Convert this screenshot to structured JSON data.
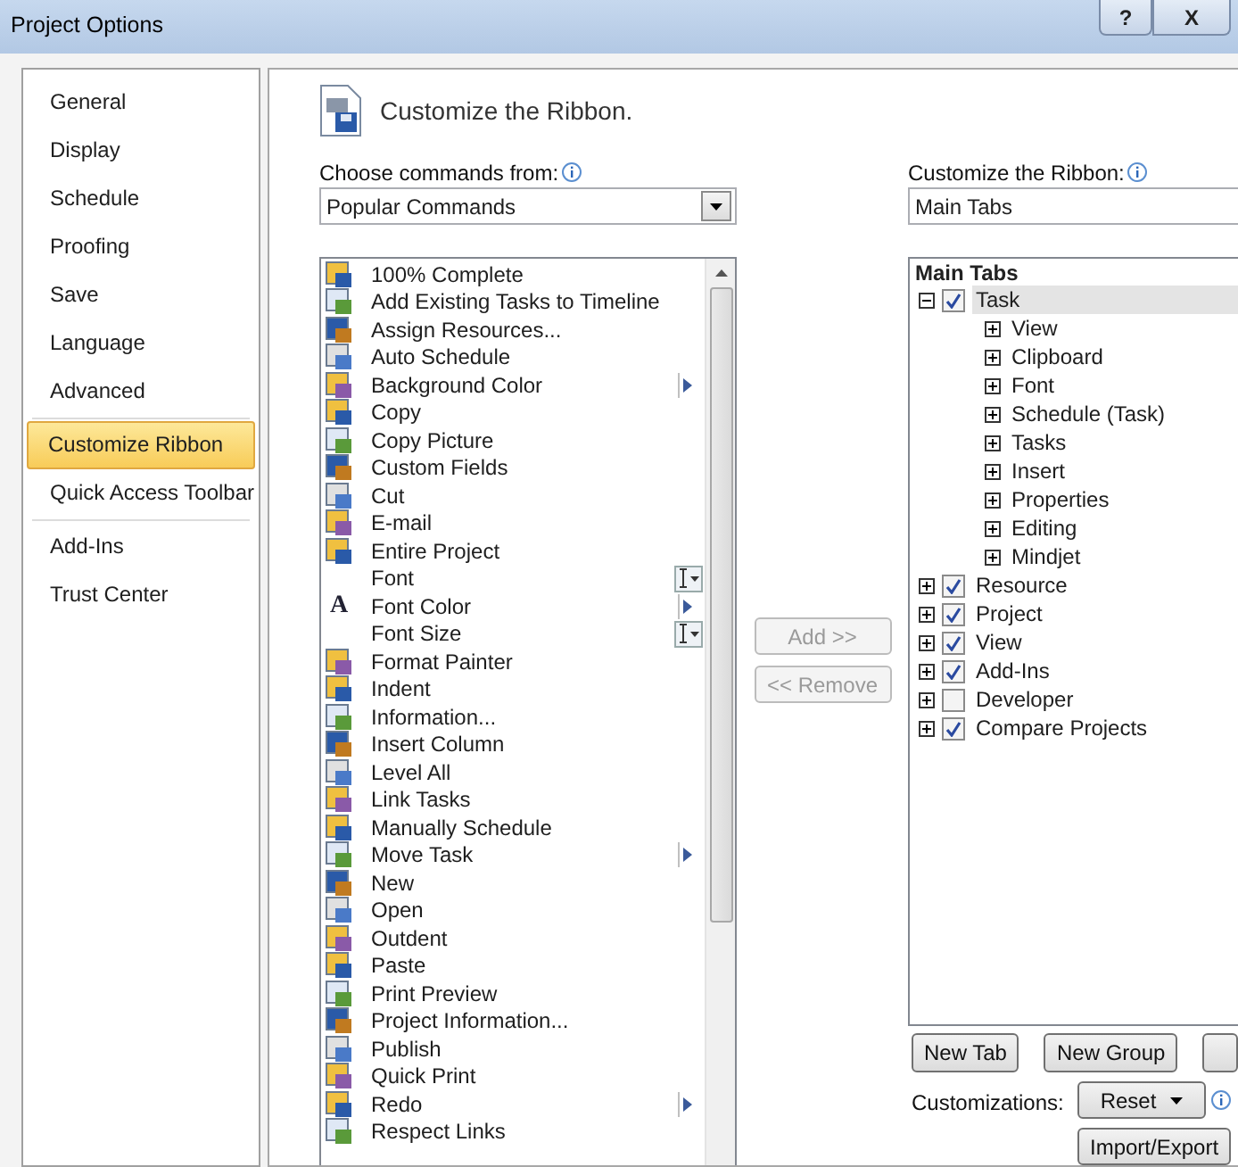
{
  "window": {
    "title": "Project Options",
    "buttons": [
      "?",
      "X"
    ]
  },
  "sidebar": {
    "sections": [
      [
        {
          "label": "General",
          "selected": false
        },
        {
          "label": "Display",
          "selected": false
        },
        {
          "label": "Schedule",
          "selected": false
        },
        {
          "label": "Proofing",
          "selected": false
        },
        {
          "label": "Save",
          "selected": false
        },
        {
          "label": "Language",
          "selected": false
        },
        {
          "label": "Advanced",
          "selected": false
        }
      ],
      [
        {
          "label": "Customize Ribbon",
          "selected": true
        },
        {
          "label": "Quick Access Toolbar",
          "selected": false
        }
      ],
      [
        {
          "label": "Add-Ins",
          "selected": false
        },
        {
          "label": "Trust Center",
          "selected": false
        }
      ]
    ]
  },
  "page": {
    "title": "Customize the Ribbon."
  },
  "commands": {
    "label": "Choose commands from:",
    "dropdown": "Popular Commands",
    "items": [
      {
        "label": "100% Complete",
        "kind": "plain"
      },
      {
        "label": "Add Existing Tasks to Timeline",
        "kind": "plain"
      },
      {
        "label": "Assign Resources...",
        "kind": "plain"
      },
      {
        "label": "Auto Schedule",
        "kind": "plain"
      },
      {
        "label": "Background Color",
        "kind": "submenu"
      },
      {
        "label": "Copy",
        "kind": "plain"
      },
      {
        "label": "Copy Picture",
        "kind": "plain"
      },
      {
        "label": "Custom Fields",
        "kind": "plain"
      },
      {
        "label": "Cut",
        "kind": "plain"
      },
      {
        "label": "E-mail",
        "kind": "plain"
      },
      {
        "label": "Entire Project",
        "kind": "plain"
      },
      {
        "label": "Font",
        "kind": "picker"
      },
      {
        "label": "Font Color",
        "kind": "submenu",
        "glyph": "A"
      },
      {
        "label": "Font Size",
        "kind": "picker"
      },
      {
        "label": "Format Painter",
        "kind": "plain"
      },
      {
        "label": "Indent",
        "kind": "plain"
      },
      {
        "label": "Information...",
        "kind": "plain"
      },
      {
        "label": "Insert Column",
        "kind": "plain"
      },
      {
        "label": "Level All",
        "kind": "plain"
      },
      {
        "label": "Link Tasks",
        "kind": "plain"
      },
      {
        "label": "Manually Schedule",
        "kind": "plain"
      },
      {
        "label": "Move Task",
        "kind": "submenu"
      },
      {
        "label": "New",
        "kind": "plain"
      },
      {
        "label": "Open",
        "kind": "plain"
      },
      {
        "label": "Outdent",
        "kind": "plain"
      },
      {
        "label": "Paste",
        "kind": "plain"
      },
      {
        "label": "Print Preview",
        "kind": "plain"
      },
      {
        "label": "Project Information...",
        "kind": "plain"
      },
      {
        "label": "Publish",
        "kind": "plain"
      },
      {
        "label": "Quick Print",
        "kind": "plain"
      },
      {
        "label": "Redo",
        "kind": "submenu"
      },
      {
        "label": "Respect Links",
        "kind": "plain"
      }
    ]
  },
  "add_button": {
    "label": "Add >>",
    "disabled": true
  },
  "remove_button": {
    "label": "<< Remove",
    "disabled": true
  },
  "ribbon": {
    "label": "Customize the Ribbon:",
    "dropdown": "Main Tabs",
    "tree": {
      "heading": "Main Tabs",
      "items": [
        {
          "label": "Task",
          "checked": true,
          "expanded": true,
          "selected": true,
          "children": [
            {
              "label": "View",
              "expanded": false,
              "selected": false
            },
            {
              "label": "Clipboard",
              "expanded": false,
              "selected": false
            },
            {
              "label": "Font",
              "expanded": false,
              "selected": false
            },
            {
              "label": "Schedule (Task)",
              "expanded": false,
              "selected": false
            },
            {
              "label": "Tasks",
              "expanded": false,
              "selected": false
            },
            {
              "label": "Insert",
              "expanded": false,
              "selected": false
            },
            {
              "label": "Properties",
              "expanded": false,
              "selected": false
            },
            {
              "label": "Editing",
              "expanded": false,
              "selected": false
            },
            {
              "label": "Mindjet",
              "expanded": false,
              "selected": false
            }
          ]
        },
        {
          "label": "Resource",
          "checked": true,
          "expanded": false,
          "selected": false
        },
        {
          "label": "Project",
          "checked": true,
          "expanded": false,
          "selected": false
        },
        {
          "label": "View",
          "checked": true,
          "expanded": false,
          "selected": false
        },
        {
          "label": "Add-Ins",
          "checked": true,
          "expanded": false,
          "selected": false
        },
        {
          "label": "Developer",
          "checked": false,
          "expanded": false,
          "selected": false
        },
        {
          "label": "Compare Projects",
          "checked": true,
          "expanded": false,
          "selected": false
        }
      ]
    }
  },
  "tree_buttons": [
    "New Tab",
    "New Group"
  ],
  "customizations": {
    "label": "Customizations:",
    "reset": "Reset",
    "import_export": "Import/Export"
  }
}
